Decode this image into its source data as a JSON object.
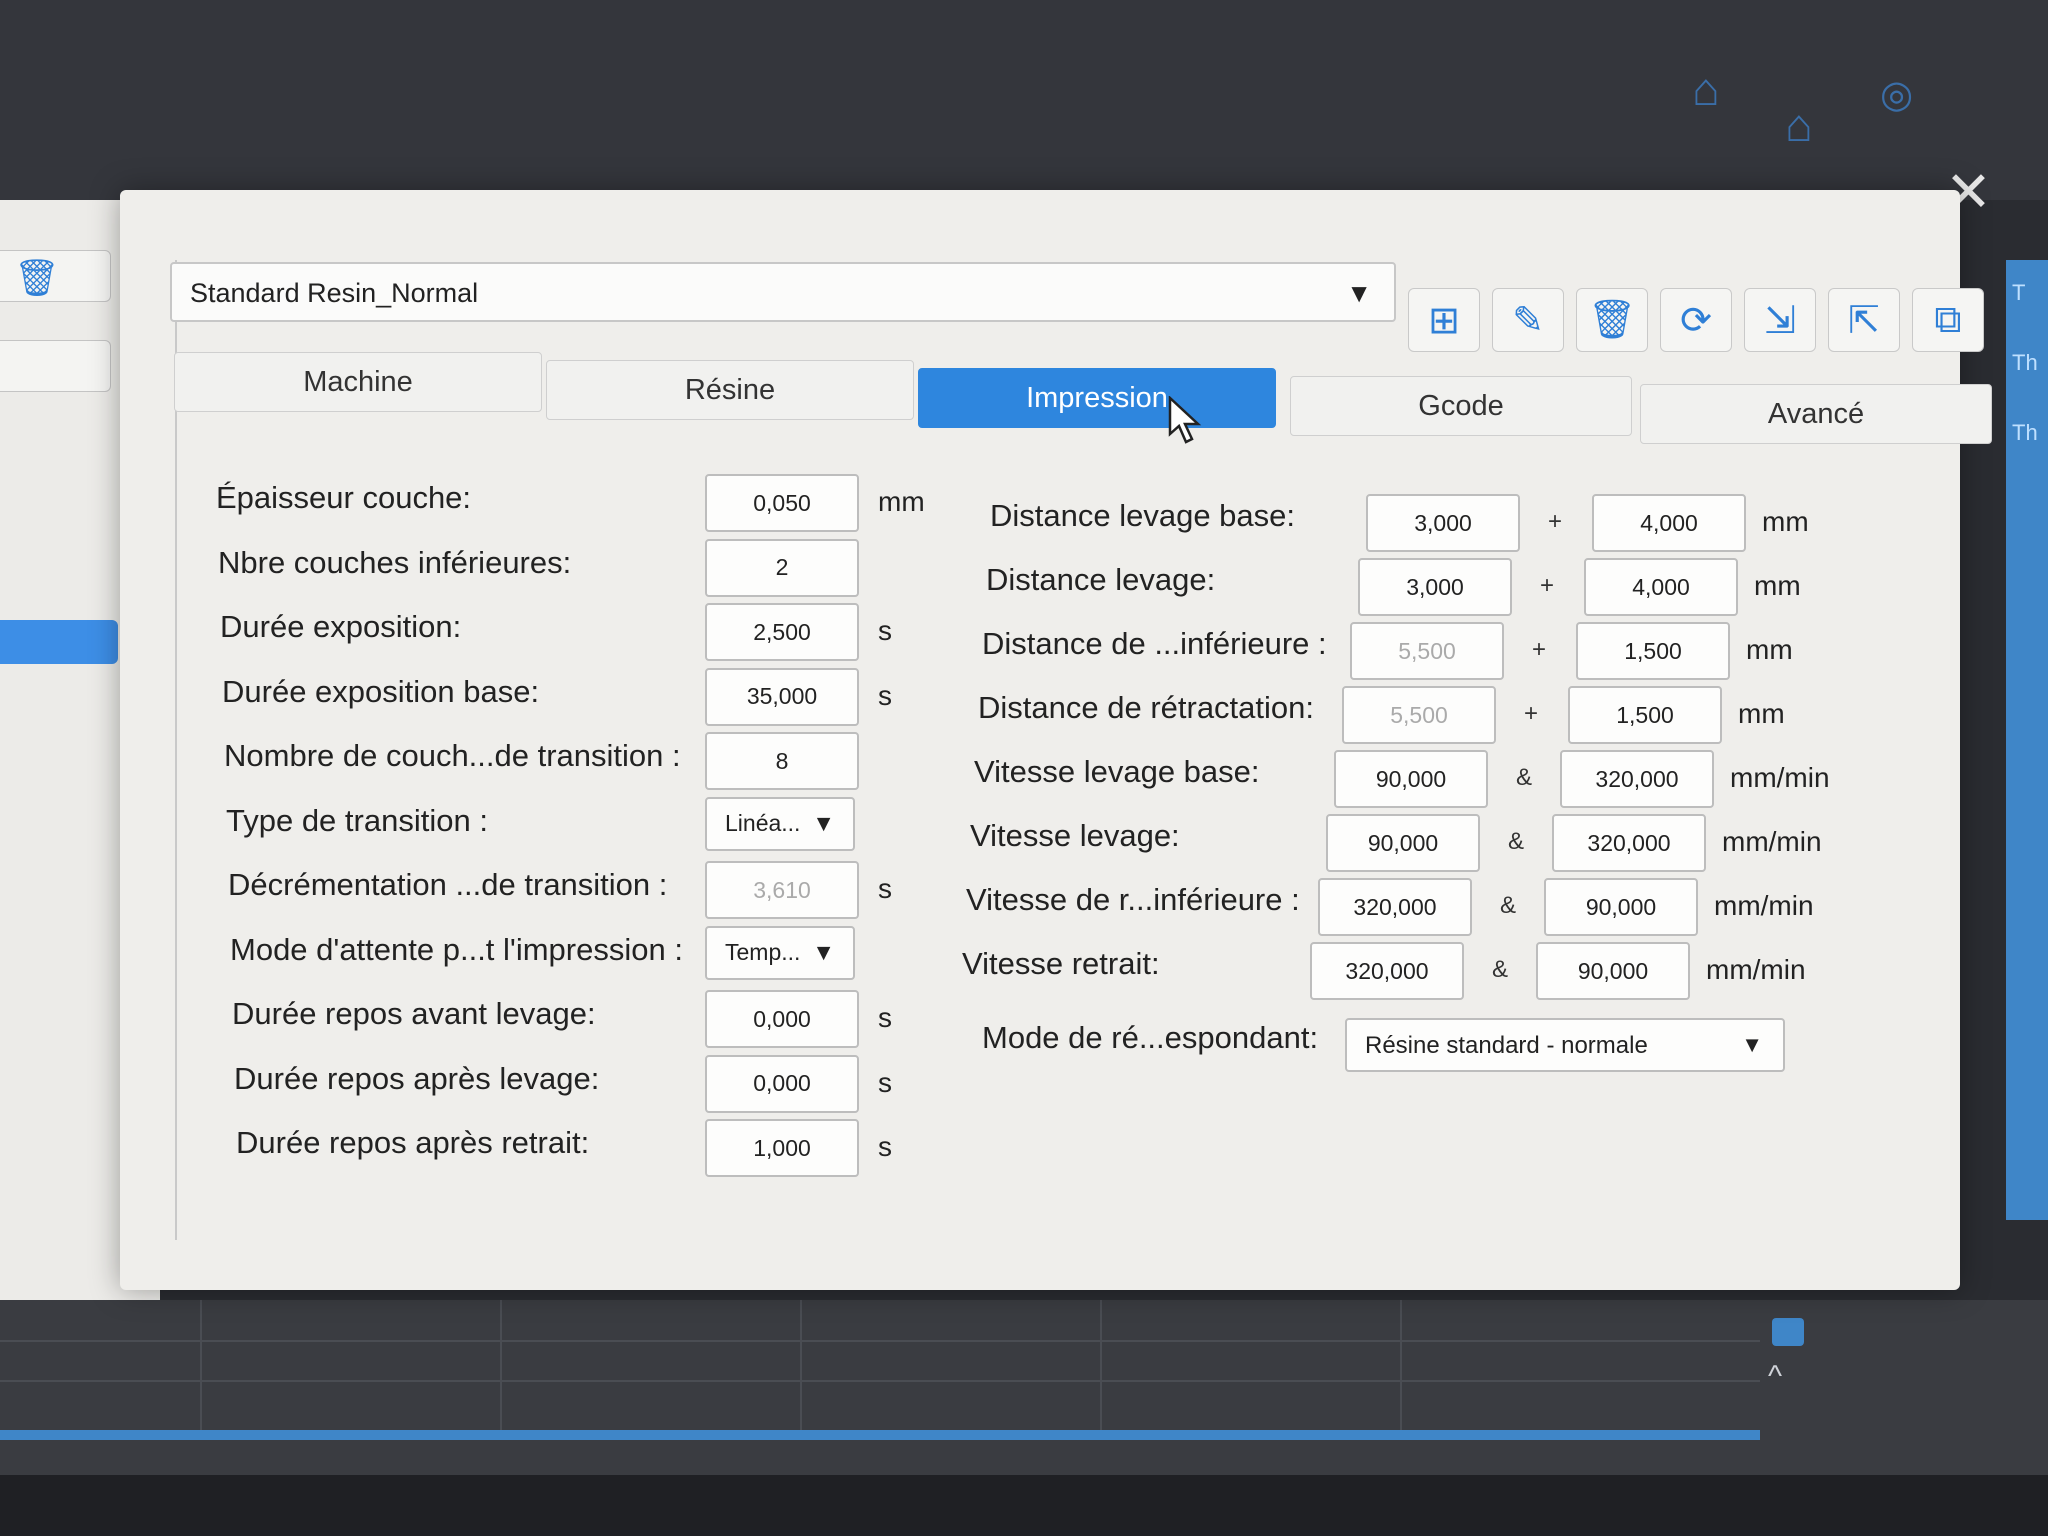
{
  "profile": {
    "selected": "Standard Resin_Normal",
    "arrow": "▼"
  },
  "toolbar": [
    {
      "icon": "⊞",
      "name": "new-profile"
    },
    {
      "icon": "✎",
      "name": "edit-profile"
    },
    {
      "icon": "🗑",
      "name": "delete-profile"
    },
    {
      "icon": "⟳",
      "name": "refresh-profile"
    },
    {
      "icon": "⇲",
      "name": "import-profile"
    },
    {
      "icon": "⇱",
      "name": "export-profile"
    },
    {
      "icon": "⧉",
      "name": "copy-profile"
    }
  ],
  "tabs": [
    {
      "label": "Machine",
      "active": false
    },
    {
      "label": "Résine",
      "active": false
    },
    {
      "label": "Impression",
      "active": true
    },
    {
      "label": "Gcode",
      "active": false
    },
    {
      "label": "Avancé",
      "active": false
    }
  ],
  "left_params": [
    {
      "label": "Épaisseur couche:",
      "value": "0,050",
      "unit": "mm"
    },
    {
      "label": "Nbre couches inférieures:",
      "value": "2",
      "unit": ""
    },
    {
      "label": "Durée exposition:",
      "value": "2,500",
      "unit": "s"
    },
    {
      "label": "Durée exposition base:",
      "value": "35,000",
      "unit": "s"
    },
    {
      "label": "Nombre de couch...de transition :",
      "value": "8",
      "unit": ""
    },
    {
      "label": "Type de transition :",
      "value": "Linéa...",
      "unit": "",
      "combo": "▼"
    },
    {
      "label": "Décrémentation ...de transition :",
      "value": "3,610",
      "unit": "s",
      "dim": true
    },
    {
      "label": "Mode d'attente p...t l'impression :",
      "value": "Temp...",
      "unit": "",
      "combo": "▼"
    },
    {
      "label": "Durée repos avant levage:",
      "value": "0,000",
      "unit": "s"
    },
    {
      "label": "Durée repos après levage:",
      "value": "0,000",
      "unit": "s"
    },
    {
      "label": "Durée repos après retrait:",
      "value": "1,000",
      "unit": "s"
    }
  ],
  "right_params": [
    {
      "label": "Distance levage base:",
      "v1": "3,000",
      "op": "+",
      "v2": "4,000",
      "unit": "mm"
    },
    {
      "label": "Distance levage:",
      "v1": "3,000",
      "op": "+",
      "v2": "4,000",
      "unit": "mm"
    },
    {
      "label": "Distance de ...inférieure :",
      "v1": "5,500",
      "op": "+",
      "v2": "1,500",
      "unit": "mm",
      "dim1": true
    },
    {
      "label": "Distance de rétractation:",
      "v1": "5,500",
      "op": "+",
      "v2": "1,500",
      "unit": "mm",
      "dim1": true
    },
    {
      "label": "Vitesse levage base:",
      "v1": "90,000",
      "op": "&",
      "v2": "320,000",
      "unit": "mm/min"
    },
    {
      "label": "Vitesse levage:",
      "v1": "90,000",
      "op": "&",
      "v2": "320,000",
      "unit": "mm/min"
    },
    {
      "label": "Vitesse de r...inférieure :",
      "v1": "320,000",
      "op": "&",
      "v2": "90,000",
      "unit": "mm/min"
    },
    {
      "label": "Vitesse retrait:",
      "v1": "320,000",
      "op": "&",
      "v2": "90,000",
      "unit": "mm/min"
    }
  ],
  "mode": {
    "label": "Mode de ré...espondant:",
    "value": "Résine standard - normale",
    "arrow": "▼"
  },
  "close_glyph": "✕",
  "side_tabs": [
    "T",
    "Th",
    "Th"
  ]
}
